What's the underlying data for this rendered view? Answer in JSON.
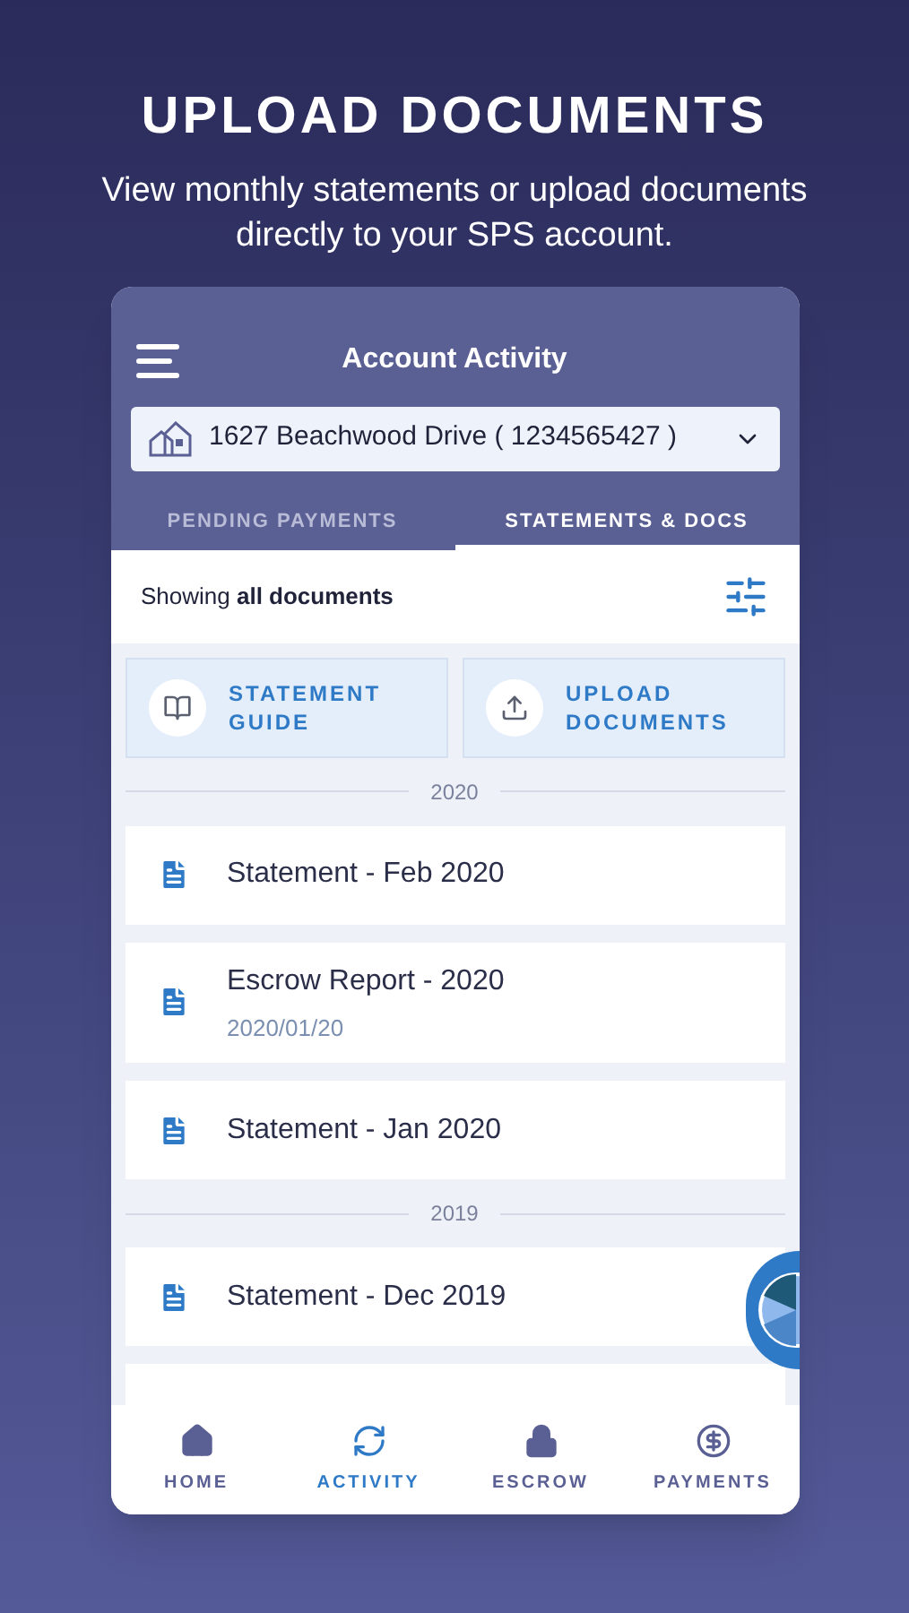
{
  "headline": "UPLOAD DOCUMENTS",
  "subtitle": "View monthly statements or upload documents directly to your SPS account.",
  "header": {
    "title": "Account Activity",
    "property": "1627 Beachwood Drive ( 1234565427 )"
  },
  "tabs": [
    {
      "label": "PENDING PAYMENTS",
      "selected": false
    },
    {
      "label": "STATEMENTS & DOCS",
      "selected": true
    }
  ],
  "filter": {
    "text": "Showing **all documents**"
  },
  "actions": [
    {
      "kind": "guide",
      "label": "STATEMENT GUIDE"
    },
    {
      "kind": "upload",
      "label": "UPLOAD DOCUMENTS"
    }
  ],
  "sections": [
    {
      "year": "2020",
      "items": [
        {
          "title": "Statement - Feb 2020"
        },
        {
          "title": "Escrow Report - 2020",
          "date": "2020/01/20"
        },
        {
          "title": "Statement - Jan 2020"
        }
      ]
    },
    {
      "year": "2019",
      "items": [
        {
          "title": "Statement - Dec 2019"
        }
      ]
    }
  ],
  "nav": [
    {
      "kind": "home",
      "label": "HOME",
      "selected": false
    },
    {
      "kind": "activity",
      "label": "ACTIVITY",
      "selected": true
    },
    {
      "kind": "escrow",
      "label": "ESCROW",
      "selected": false
    },
    {
      "kind": "payments",
      "label": "PAYMENTS",
      "selected": false
    }
  ]
}
